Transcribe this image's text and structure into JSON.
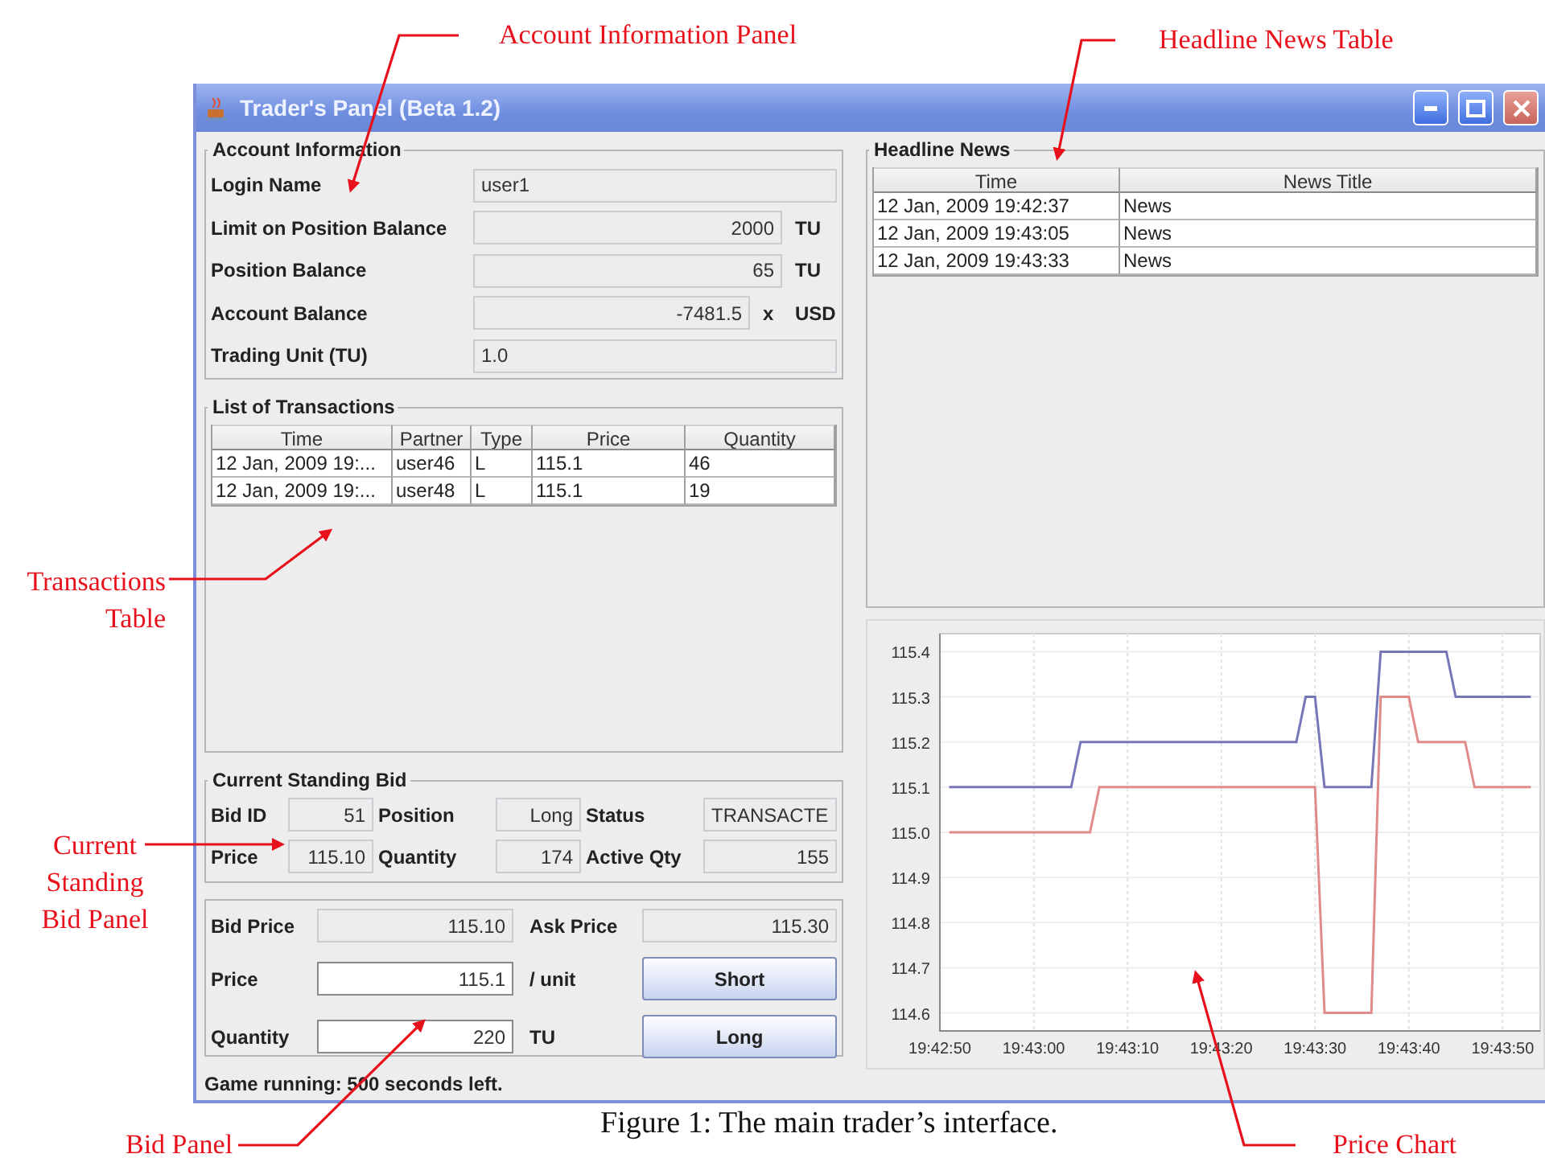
{
  "window": {
    "title": "Trader's Panel (Beta 1.2)"
  },
  "account_information": {
    "title": "Account Information",
    "rows": [
      {
        "label": "Login Name",
        "value": "user1",
        "kind": "text"
      },
      {
        "label": "Limit on Position Balance",
        "value": "2000",
        "unit": "TU",
        "kind": "number"
      },
      {
        "label": "Position Balance",
        "value": "65",
        "unit": "TU",
        "kind": "number"
      },
      {
        "label": "Account Balance",
        "value": "-7481.5",
        "suffix": "x",
        "unit": "USD",
        "kind": "number"
      },
      {
        "label": "Trading Unit (TU)",
        "value": "1.0",
        "kind": "text"
      }
    ]
  },
  "transactions": {
    "title": "List of Transactions",
    "columns": [
      "Time",
      "Partner",
      "Type",
      "Price",
      "Quantity"
    ],
    "rows": [
      [
        "12 Jan, 2009 19:...",
        "user46",
        "L",
        "115.1",
        "46"
      ],
      [
        "12 Jan, 2009 19:...",
        "user48",
        "L",
        "115.1",
        "19"
      ]
    ]
  },
  "current_standing_bid": {
    "title": "Current Standing Bid",
    "fields": [
      {
        "label": "Bid ID",
        "value": "51"
      },
      {
        "label": "Position",
        "value": "Long"
      },
      {
        "label": "Status",
        "value": "TRANSACTE",
        "kind": "text"
      },
      {
        "label": "Price",
        "value": "115.10"
      },
      {
        "label": "Quantity",
        "value": "174"
      },
      {
        "label": "Active Qty",
        "value": "155"
      }
    ]
  },
  "bid_panel": {
    "bid_price": {
      "label": "Bid Price",
      "value": "115.10"
    },
    "ask_price": {
      "label": "Ask Price",
      "value": "115.30"
    },
    "inputs": [
      {
        "label": "Price",
        "value": "115.1",
        "unit": "/ unit",
        "button": "Short"
      },
      {
        "label": "Quantity",
        "value": "220",
        "unit": "TU",
        "button": "Long"
      }
    ]
  },
  "status_bar": "Game running: 500 seconds left.",
  "headline_news": {
    "title": "Headline News",
    "columns": [
      "Time",
      "News Title"
    ],
    "rows": [
      [
        "12 Jan, 2009 19:42:37",
        "News"
      ],
      [
        "12 Jan, 2009 19:43:05",
        "News"
      ],
      [
        "12 Jan, 2009 19:43:33",
        "News"
      ]
    ]
  },
  "price_chart": {
    "chart_data": {
      "type": "line",
      "categories": [
        "19:42:50",
        null,
        null,
        null,
        null,
        null,
        null,
        null,
        null,
        null,
        "19:43:00",
        null,
        null,
        null,
        null,
        null,
        null,
        null,
        null,
        null,
        "19:43:10",
        null,
        null,
        null,
        null,
        null,
        null,
        null,
        null,
        null,
        "19:43:20",
        null,
        null,
        null,
        null,
        null,
        null,
        null,
        null,
        null,
        "19:43:30",
        null,
        null,
        null,
        null,
        null,
        null,
        null,
        null,
        null,
        "19:43:40",
        null,
        null,
        null,
        null,
        null,
        null,
        null,
        null,
        null,
        "19:43:50",
        null,
        null,
        null
      ],
      "series": [
        {
          "color": "#7676b8",
          "values": [
            null,
            115.1,
            115.1,
            115.1,
            115.1,
            115.1,
            115.1,
            115.1,
            115.1,
            115.1,
            115.1,
            115.1,
            115.1,
            115.1,
            115.1,
            115.2,
            115.2,
            115.2,
            115.2,
            115.2,
            115.2,
            115.2,
            115.2,
            115.2,
            115.2,
            115.2,
            115.2,
            115.2,
            115.2,
            115.2,
            115.2,
            115.2,
            115.2,
            115.2,
            115.2,
            115.2,
            115.2,
            115.2,
            115.2,
            115.3,
            115.3,
            115.1,
            115.1,
            115.1,
            115.1,
            115.1,
            115.1,
            115.4,
            115.4,
            115.4,
            115.4,
            115.4,
            115.4,
            115.4,
            115.4,
            115.3,
            115.3,
            115.3,
            115.3,
            115.3,
            115.3,
            115.3,
            115.3,
            115.3
          ]
        },
        {
          "color": "#e08a8a",
          "values": [
            null,
            115.0,
            115.0,
            115.0,
            115.0,
            115.0,
            115.0,
            115.0,
            115.0,
            115.0,
            115.0,
            115.0,
            115.0,
            115.0,
            115.0,
            115.0,
            115.0,
            115.1,
            115.1,
            115.1,
            115.1,
            115.1,
            115.1,
            115.1,
            115.1,
            115.1,
            115.1,
            115.1,
            115.1,
            115.1,
            115.1,
            115.1,
            115.1,
            115.1,
            115.1,
            115.1,
            115.1,
            115.1,
            115.1,
            115.1,
            115.1,
            114.6,
            114.6,
            114.6,
            114.6,
            114.6,
            114.6,
            115.3,
            115.3,
            115.3,
            115.3,
            115.2,
            115.2,
            115.2,
            115.2,
            115.2,
            115.2,
            115.1,
            115.1,
            115.1,
            115.1,
            115.1,
            115.1,
            115.1
          ]
        }
      ],
      "grid": true,
      "ylim": [
        114.56,
        115.44
      ],
      "yticks": [
        {
          "value": 114.6,
          "label": "114.6"
        },
        {
          "value": 114.7,
          "label": "114.7"
        },
        {
          "value": 114.8,
          "label": "114.8"
        },
        {
          "value": 114.9,
          "label": "114.9"
        },
        {
          "value": 115.0,
          "label": "115.0"
        },
        {
          "value": 115.1,
          "label": "115.1"
        },
        {
          "value": 115.2,
          "label": "115.2"
        },
        {
          "value": 115.3,
          "label": "115.3"
        },
        {
          "value": 115.4,
          "label": "115.4"
        }
      ]
    }
  },
  "annotations": [
    {
      "lines": [
        "Account Information Panel"
      ]
    },
    {
      "lines": [
        "Headline News Table"
      ]
    },
    {
      "lines": [
        "Transactions",
        "Table"
      ]
    },
    {
      "lines": [
        "Current",
        "Standing",
        "Bid Panel"
      ]
    },
    {
      "lines": [
        "Bid Panel"
      ]
    },
    {
      "lines": [
        "Price Chart"
      ]
    }
  ],
  "caption": "Figure 1: The main trader’s interface."
}
